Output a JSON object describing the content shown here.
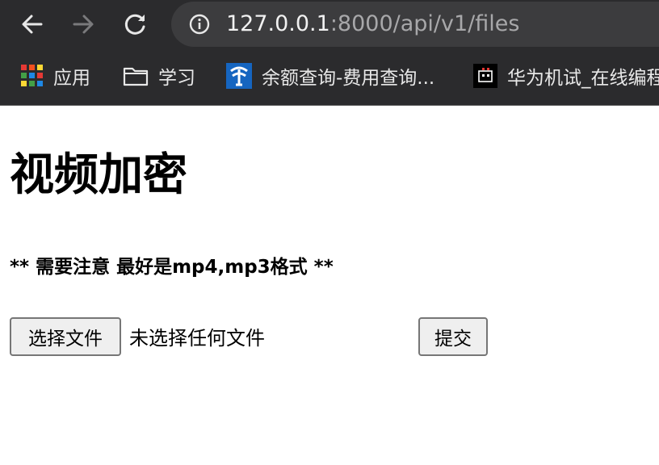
{
  "browser": {
    "url": {
      "host": "127.0.0.1",
      "path": ":8000/api/v1/files"
    },
    "bookmarks": [
      {
        "label": "应用",
        "icon": "apps-grid-icon"
      },
      {
        "label": "学习",
        "icon": "folder-icon"
      },
      {
        "label": "余额查询-费用查询...",
        "icon": "china-telecom-icon"
      },
      {
        "label": "华为机试_在线编程",
        "icon": "nowcoder-icon"
      }
    ]
  },
  "page": {
    "title": "视频加密",
    "note": "** 需要注意 最好是mp4,mp3格式 **",
    "file_input": {
      "button_label": "选择文件",
      "status": "未选择任何文件"
    },
    "submit_label": "提交"
  },
  "colors": {
    "chrome_background": "#2b2b2d",
    "omnibox_background": "#3c3c3e",
    "url_host": "#f1f1f1",
    "url_path": "#a8a8aa",
    "button_background": "#efefef",
    "button_border": "#767676"
  }
}
